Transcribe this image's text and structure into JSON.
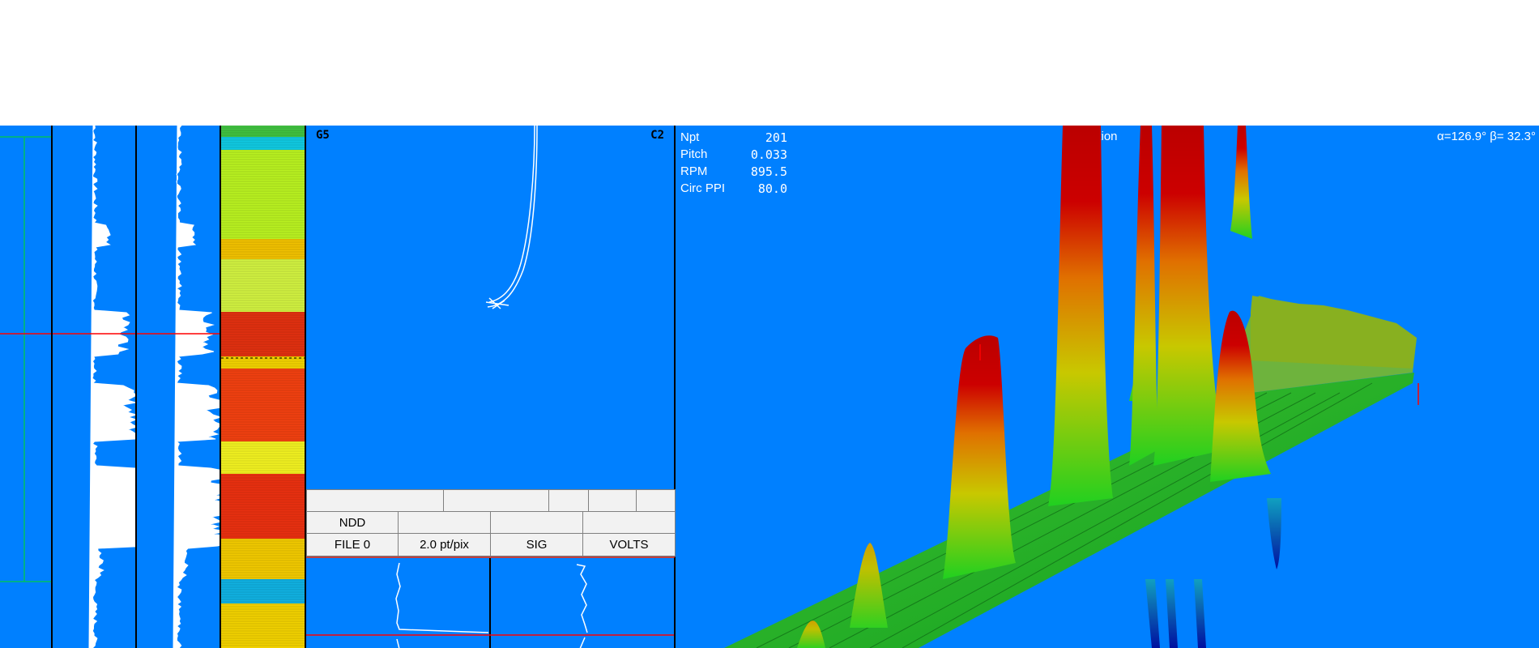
{
  "graphic": {
    "left_label": "G5",
    "right_label": "C2"
  },
  "table": {
    "row2": [
      "NDD",
      "",
      "",
      ""
    ],
    "row3": [
      "FILE 0",
      "2.0 pt/pix",
      "SIG",
      "VOLTS"
    ]
  },
  "info": [
    {
      "key": "Npt",
      "value": "201"
    },
    {
      "key": "Pitch",
      "value": "0.033"
    },
    {
      "key": "RPM",
      "value": "895.5"
    },
    {
      "key": "Circ PPI",
      "value": "80.0"
    }
  ],
  "view3d": {
    "title_fragment": "ation",
    "angles": "α=126.9° β= 32.3°"
  },
  "colors": {
    "background": "#0080ff",
    "trace": "#ffffff",
    "marker": "#ff0000",
    "grid": "#00c060"
  }
}
